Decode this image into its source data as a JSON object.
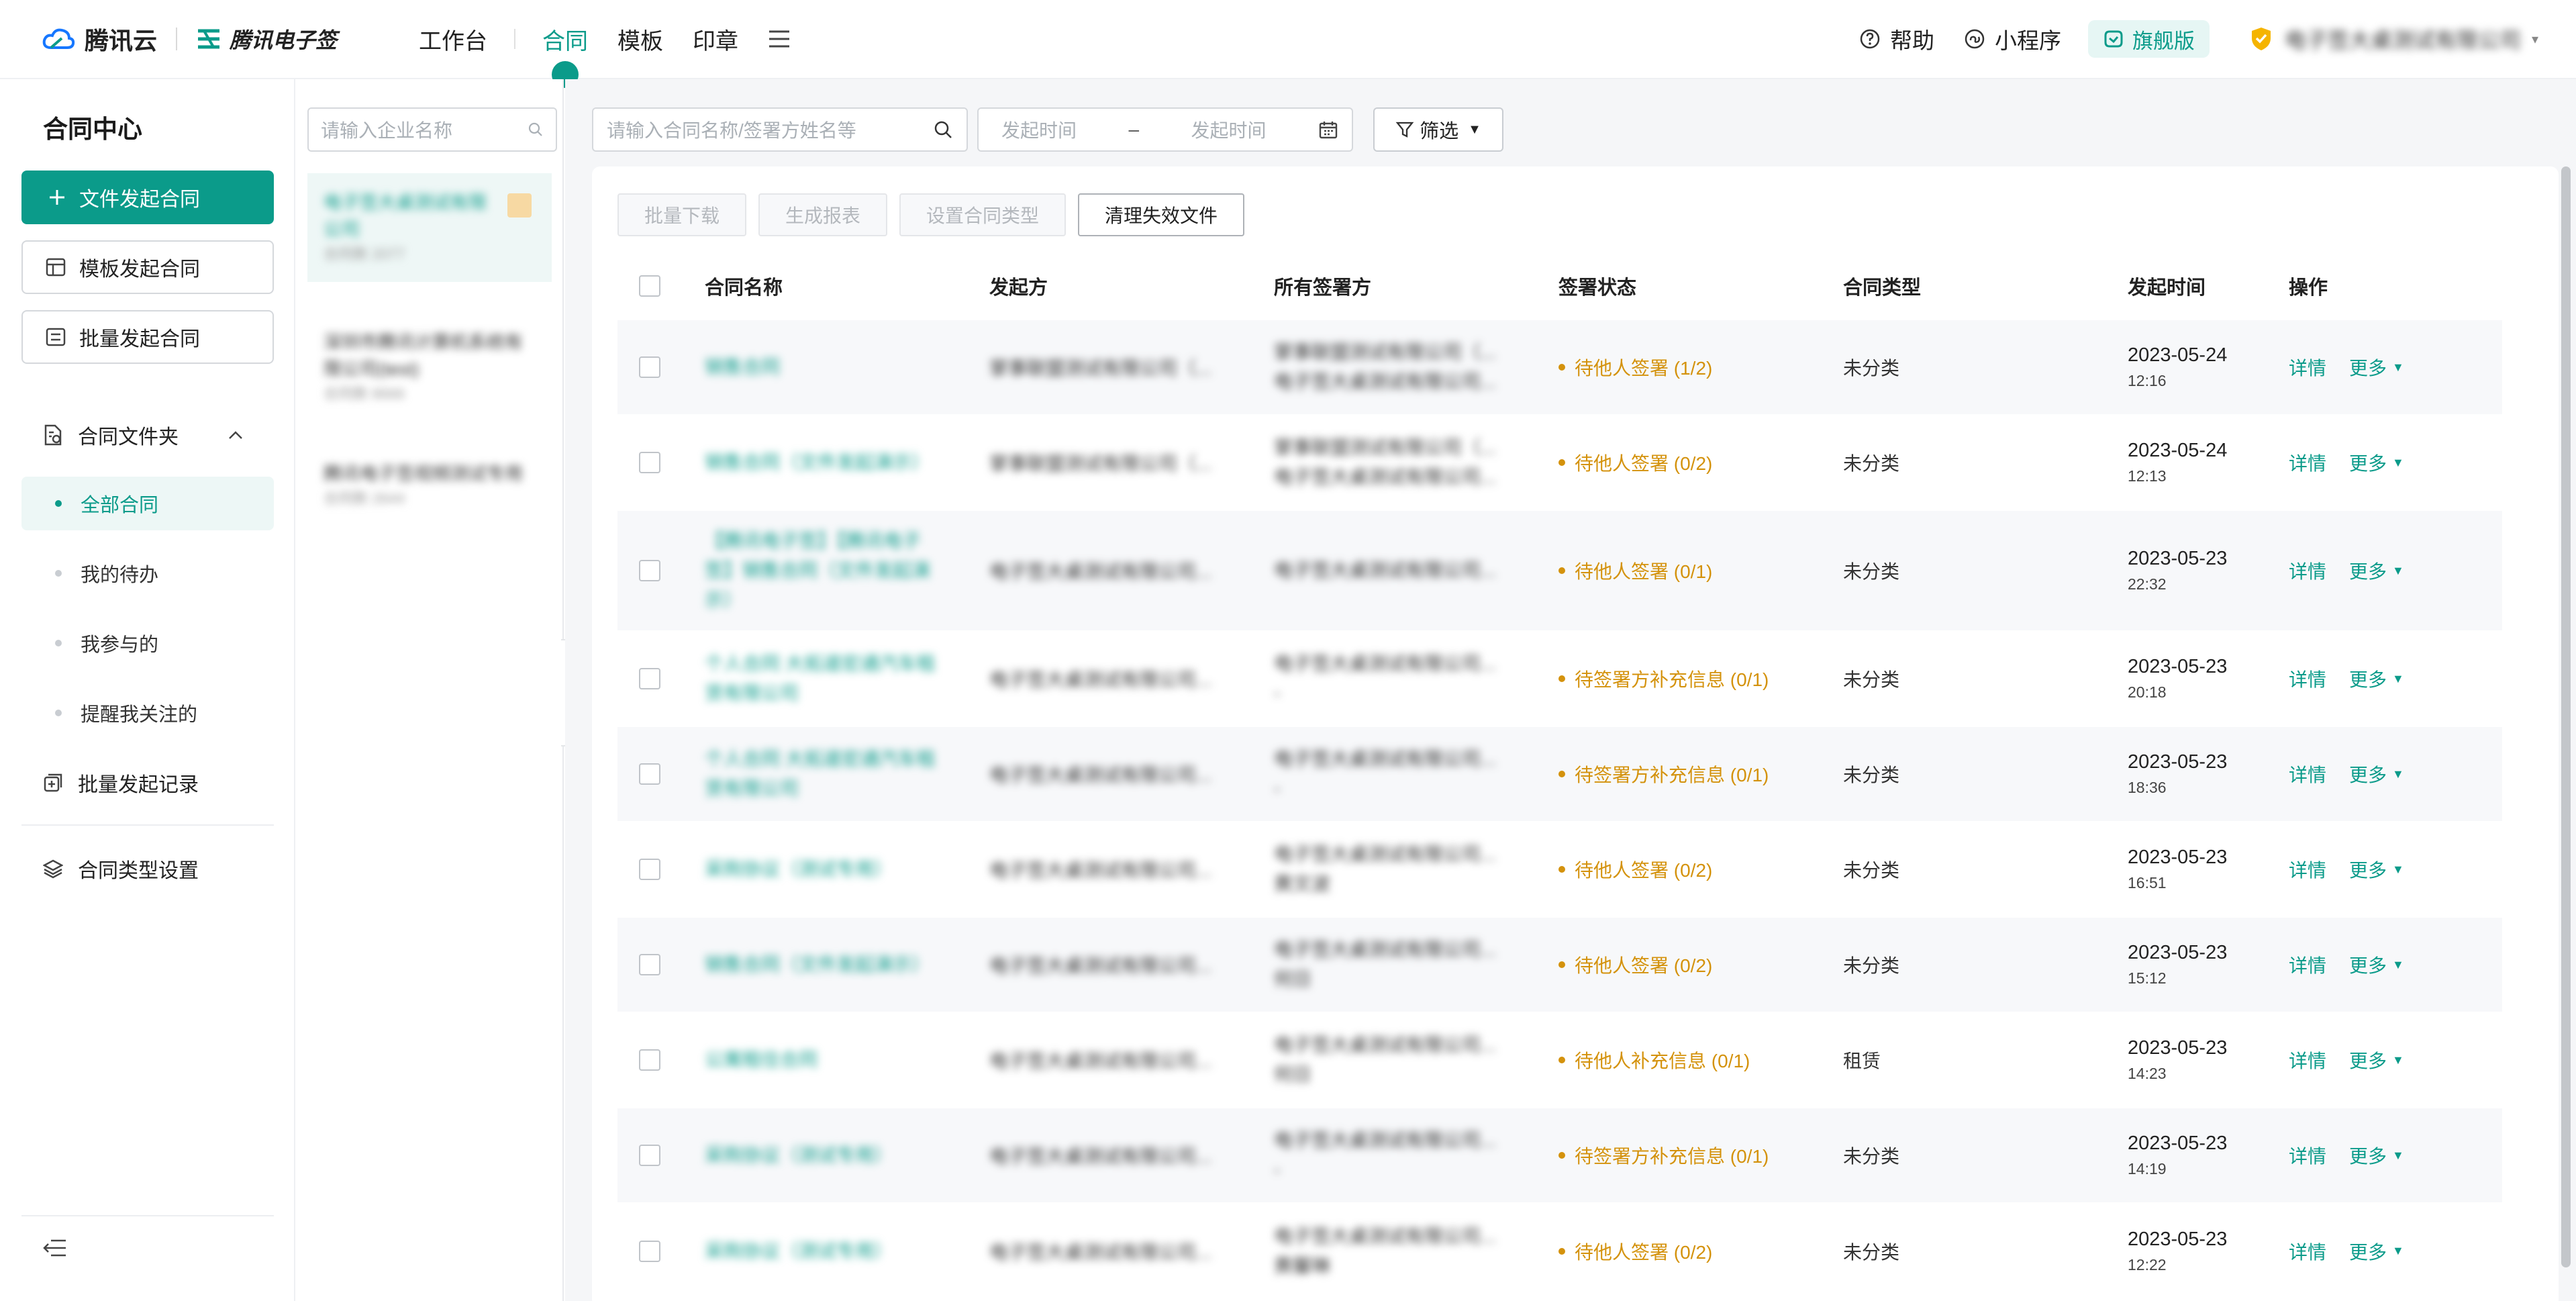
{
  "brand": {
    "cloud_name": "腾讯云",
    "product_name": "腾讯电子签"
  },
  "top_nav": {
    "items": [
      "工作台",
      "合同",
      "模板",
      "印章"
    ],
    "active": "合同"
  },
  "top_right": {
    "help": "帮助",
    "mini_program": "小程序",
    "edition": "旗舰版",
    "company": "电子签大桌测试有限公司"
  },
  "sidebar": {
    "title": "合同中心",
    "primary_button": "文件发起合同",
    "template_button": "模板发起合同",
    "batch_button": "批量发起合同",
    "folder_label": "合同文件夹",
    "sub_items": [
      "全部合同",
      "我的待办",
      "我参与的",
      "提醒我关注的"
    ],
    "batch_record": "批量发起记录",
    "type_settings": "合同类型设置"
  },
  "org_column": {
    "search_placeholder": "请输入企业名称",
    "items": [
      {
        "name": "电子签大桌测试有限公司",
        "count": "合同数 2077"
      },
      {
        "name": "深圳市腾讯计算机系统有限公司(test)",
        "count": "合同数 8666"
      },
      {
        "name": "腾讯电子签视频测试专用",
        "count": "合同数 2644"
      }
    ]
  },
  "filters": {
    "search_placeholder": "请输入合同名称/签署方姓名等",
    "date_start": "发起时间",
    "date_sep": "–",
    "date_end": "发起时间",
    "filter_button": "筛选"
  },
  "toolbar": {
    "batch_download": "批量下载",
    "gen_report": "生成报表",
    "set_type": "设置合同类型",
    "clean_invalid": "清理失效文件"
  },
  "table": {
    "headers": [
      "合同名称",
      "发起方",
      "所有签署方",
      "签署状态",
      "合同类型",
      "发起时间",
      "操作"
    ],
    "detail_label": "详情",
    "more_label": "更多",
    "rows": [
      {
        "name": "销售合同",
        "initiator": "掌事联盟测试有限公司（...",
        "signer1": "掌事联盟测试有限公司（...",
        "signer2": "电子签大桌测试有限公司...",
        "status": "待他人签署 (1/2)",
        "type": "未分类",
        "date": "2023-05-24",
        "time": "12:16"
      },
      {
        "name": "销售合同（文件发起演示）",
        "initiator": "掌事联盟测试有限公司（...",
        "signer1": "掌事联盟测试有限公司（...",
        "signer2": "电子签大桌测试有限公司...",
        "status": "待他人签署 (0/2)",
        "type": "未分类",
        "date": "2023-05-24",
        "time": "12:13"
      },
      {
        "name": "【腾讯电子签】【腾讯电子签】销售合同（文件发起演示）",
        "initiator": "电子签大桌测试有限公司...",
        "signer1": "电子签大桌测试有限公司...",
        "signer2": "",
        "status": "待他人签署 (0/1)",
        "type": "未分类",
        "date": "2023-05-23",
        "time": "22:32"
      },
      {
        "name": "个人合同 大拓道宏通汽车租赁有限公司",
        "initiator": "电子签大桌测试有限公司...",
        "signer1": "电子签大桌测试有限公司...",
        "signer2": "-",
        "status": "待签署方补充信息 (0/1)",
        "type": "未分类",
        "date": "2023-05-23",
        "time": "20:18"
      },
      {
        "name": "个人合同 大拓道宏通汽车租赁有限公司",
        "initiator": "电子签大桌测试有限公司...",
        "signer1": "电子签大桌测试有限公司...",
        "signer2": "-",
        "status": "待签署方补充信息 (0/1)",
        "type": "未分类",
        "date": "2023-05-23",
        "time": "18:36"
      },
      {
        "name": "采购协议（测试专用）",
        "initiator": "电子签大桌测试有限公司...",
        "signer1": "电子签大桌测试有限公司...",
        "signer2": "黄文波",
        "status": "待他人签署 (0/2)",
        "type": "未分类",
        "date": "2023-05-23",
        "time": "16:51"
      },
      {
        "name": "销售合同（文件发起演示）",
        "initiator": "电子签大桌测试有限公司...",
        "signer1": "电子签大桌测试有限公司...",
        "signer2": "何日",
        "status": "待他人签署 (0/2)",
        "type": "未分类",
        "date": "2023-05-23",
        "time": "15:12"
      },
      {
        "name": "公寓租住合同",
        "initiator": "电子签大桌测试有限公司...",
        "signer1": "电子签大桌测试有限公司...",
        "signer2": "何日",
        "status": "待他人补充信息 (0/1)",
        "type": "租赁",
        "date": "2023-05-23",
        "time": "14:23"
      },
      {
        "name": "采购协议（测试专用）",
        "initiator": "电子签大桌测试有限公司...",
        "signer1": "电子签大桌测试有限公司...",
        "signer2": "-",
        "status": "待签署方补充信息 (0/1)",
        "type": "未分类",
        "date": "2023-05-23",
        "time": "14:19"
      },
      {
        "name": "采购协议（测试专用）",
        "initiator": "电子签大桌测试有限公司...",
        "signer1": "电子签大桌测试有限公司...",
        "signer2": "黄馨琳",
        "status": "待他人签署 (0/2)",
        "type": "未分类",
        "date": "2023-05-23",
        "time": "12:22"
      }
    ]
  },
  "colors": {
    "brand": "#0b9b8a",
    "status_pending": "#d4920c"
  }
}
